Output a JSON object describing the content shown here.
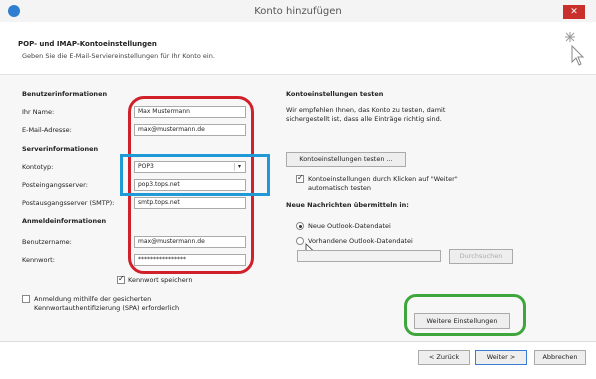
{
  "window": {
    "title": "Konto hinzufügen",
    "close_glyph": "✕"
  },
  "header": {
    "title": "POP- und IMAP-Kontoeinstellungen",
    "subtitle": "Geben Sie die E-Mail-Serviereinstellungen für Ihr Konto ein."
  },
  "user_info": {
    "heading": "Benutzerinformationen",
    "name_label": "Ihr Name:",
    "name_value": "Max Mustermann",
    "email_label": "E-Mail-Adresse:",
    "email_value": "max@mustermann.de"
  },
  "server_info": {
    "heading": "Serverinformationen",
    "type_label": "Kontotyp:",
    "type_value": "POP3",
    "incoming_label": "Posteingangsserver:",
    "incoming_value": "pop3.tops.net",
    "outgoing_label": "Postausgangsserver (SMTP):",
    "outgoing_value": "smtp.tops.net"
  },
  "login_info": {
    "heading": "Anmeldeinformationen",
    "user_label": "Benutzername:",
    "user_value": "max@mustermann.de",
    "password_label": "Kennwort:",
    "password_value": "****************",
    "remember_label": "Kennwort speichern",
    "spa_label_1": "Anmeldung mithilfe der gesicherten",
    "spa_label_2": "Kennwortauthentifizierung (SPA) erforderlich"
  },
  "test": {
    "heading": "Kontoeinstellungen testen",
    "text_1": "Wir empfehlen Ihnen, das Konto zu testen, damit",
    "text_2": "sichergestellt ist, dass alle Einträge richtig sind.",
    "button": "Kontoeinstellungen testen ...",
    "auto_label_1": "Kontoeinstellungen durch Klicken auf \"Weiter\"",
    "auto_label_2": "automatisch testen"
  },
  "delivery": {
    "heading": "Neue Nachrichten übermitteln in:",
    "new_file": "Neue Outlook-Datendatei",
    "existing_file": "Vorhandene Outlook-Datendatei",
    "browse": "Durchsuchen"
  },
  "more_settings": "Weitere Einstellungen",
  "footer": {
    "back": "< Zurück",
    "next": "Weiter >",
    "cancel": "Abbrechen"
  },
  "colors": {
    "red_highlight": "#d0202a",
    "blue_highlight": "#1f9ad6",
    "green_highlight": "#3fa63b"
  }
}
